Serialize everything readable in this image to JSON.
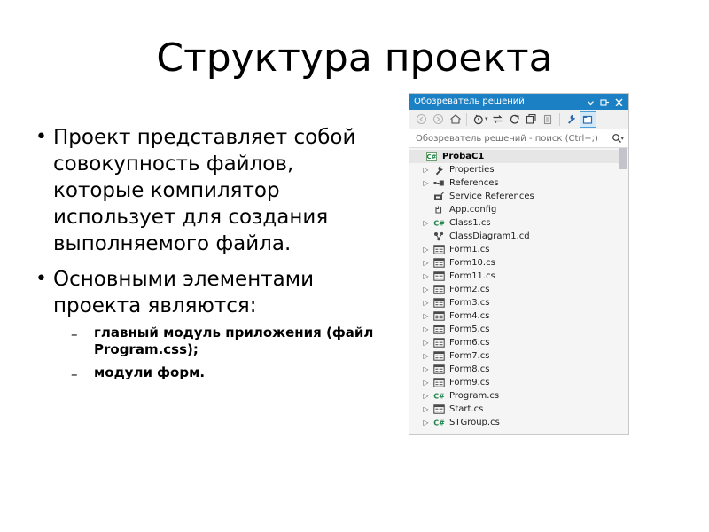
{
  "slide": {
    "title": "Структура проекта",
    "bullet_marker": "•",
    "sub_marker": "–",
    "bullets": [
      {
        "text": "Проект представляет собой совокупность файлов, которые компилятор использует для создания выполняемого файла."
      },
      {
        "text": "Основными элементами проекта являются:",
        "sub": [
          "главный модуль приложения (файл Program.css);",
          " модули форм."
        ]
      }
    ]
  },
  "solution_explorer": {
    "title": "Обозреватель решений",
    "titlebar_color": "#1c80c4",
    "title_buttons": [
      {
        "name": "chevron-down-icon",
        "label": "▾"
      },
      {
        "name": "pin-icon",
        "label": "⊣"
      },
      {
        "name": "close-icon",
        "label": "✕"
      }
    ],
    "toolbar": [
      {
        "name": "back-icon",
        "tooltip": "Назад"
      },
      {
        "name": "forward-icon",
        "tooltip": "Вперед"
      },
      {
        "name": "home-icon",
        "tooltip": "Домой"
      },
      {
        "name": "pending-changes-icon",
        "tooltip": "Ожидающие изменения"
      },
      {
        "name": "sync-icon",
        "tooltip": "Синхронизировать"
      },
      {
        "name": "refresh-icon",
        "tooltip": "Обновить"
      },
      {
        "name": "collapse-all-icon",
        "tooltip": "Свернуть все"
      },
      {
        "name": "show-all-files-icon",
        "tooltip": "Показать все файлы"
      },
      {
        "name": "properties-wrench-icon",
        "tooltip": "Свойства"
      },
      {
        "name": "preview-selected-items-icon",
        "tooltip": "Предварительный просмотр выбранных элементов",
        "selected": true
      }
    ],
    "search": {
      "placeholder": "Обозреватель решений - поиск (Ctrl+;)",
      "icon": "search-icon",
      "dropdown_caret": "▾"
    },
    "tree": {
      "expand_arrow": "▷",
      "items": [
        {
          "label": "ProbaC1",
          "icon": "csharp-project-icon",
          "arrow": false,
          "indent": 1,
          "selected": true
        },
        {
          "label": "Properties",
          "icon": "wrench-icon",
          "arrow": true,
          "indent": 2,
          "selected": false
        },
        {
          "label": "References",
          "icon": "references-icon",
          "arrow": true,
          "indent": 2,
          "selected": false
        },
        {
          "label": "Service References",
          "icon": "service-references-icon",
          "arrow": false,
          "indent": 2,
          "selected": false
        },
        {
          "label": "App.config",
          "icon": "config-file-icon",
          "arrow": false,
          "indent": 2,
          "selected": false
        },
        {
          "label": "Class1.cs",
          "icon": "csharp-file-icon",
          "arrow": true,
          "indent": 2,
          "selected": false
        },
        {
          "label": "ClassDiagram1.cd",
          "icon": "class-diagram-icon",
          "arrow": false,
          "indent": 2,
          "selected": false
        },
        {
          "label": "Form1.cs",
          "icon": "windows-form-icon",
          "arrow": true,
          "indent": 2,
          "selected": false
        },
        {
          "label": "Form10.cs",
          "icon": "windows-form-icon",
          "arrow": true,
          "indent": 2,
          "selected": false
        },
        {
          "label": "Form11.cs",
          "icon": "windows-form-icon",
          "arrow": true,
          "indent": 2,
          "selected": false
        },
        {
          "label": "Form2.cs",
          "icon": "windows-form-icon",
          "arrow": true,
          "indent": 2,
          "selected": false
        },
        {
          "label": "Form3.cs",
          "icon": "windows-form-icon",
          "arrow": true,
          "indent": 2,
          "selected": false
        },
        {
          "label": "Form4.cs",
          "icon": "windows-form-icon",
          "arrow": true,
          "indent": 2,
          "selected": false
        },
        {
          "label": "Form5.cs",
          "icon": "windows-form-icon",
          "arrow": true,
          "indent": 2,
          "selected": false
        },
        {
          "label": "Form6.cs",
          "icon": "windows-form-icon",
          "arrow": true,
          "indent": 2,
          "selected": false
        },
        {
          "label": "Form7.cs",
          "icon": "windows-form-icon",
          "arrow": true,
          "indent": 2,
          "selected": false
        },
        {
          "label": "Form8.cs",
          "icon": "windows-form-icon",
          "arrow": true,
          "indent": 2,
          "selected": false
        },
        {
          "label": "Form9.cs",
          "icon": "windows-form-icon",
          "arrow": true,
          "indent": 2,
          "selected": false
        },
        {
          "label": "Program.cs",
          "icon": "csharp-file-icon",
          "arrow": true,
          "indent": 2,
          "selected": false
        },
        {
          "label": "Start.cs",
          "icon": "windows-form-icon",
          "arrow": true,
          "indent": 2,
          "selected": false
        },
        {
          "label": "STGroup.cs",
          "icon": "csharp-file-icon",
          "arrow": true,
          "indent": 2,
          "selected": false
        }
      ]
    }
  }
}
